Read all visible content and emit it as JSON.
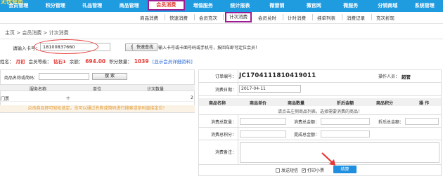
{
  "brand": "无忧会员",
  "topnav": [
    "会员管理",
    "积分管理",
    "礼品管理",
    "商品管理",
    "会员消费",
    "增值服务",
    "统计报表",
    "微营销",
    "微官网",
    "微服务",
    "分销商城",
    "系统管理"
  ],
  "subnav": [
    "商品消费",
    "快速消费",
    "会员充次",
    "计次消费",
    "会员兑时",
    "计时消费",
    "挂单列表",
    "消费记录",
    "充次折现"
  ],
  "breadcrumb": "主页 > 会员消费 > 计次消费",
  "card": {
    "label": "请输入卡号：",
    "value": "18100837660",
    "search_btn": "查 找",
    "quick_btn": "快速查找",
    "tip": "输入卡号或卡面号码或手机号，按回车即可定位会员！"
  },
  "info": {
    "name_label": "姓名：",
    "name": "月初",
    "level_label": "会员等级：",
    "level": "钻石1",
    "balance_label": "余额：",
    "balance": "694.00",
    "points_label": "积分数量：",
    "points": "1039",
    "detail_link": "[显示会员详细资料]"
  },
  "left": {
    "search_label": "商品名称或简码：",
    "search_btn": "搜 索",
    "columns": [
      "服务名称",
      "单位",
      "计次数量"
    ],
    "rows": [
      [
        "门票",
        "个",
        "2"
      ]
    ],
    "note": "点击商品即可轻松选定，也可以通过名称或简码进行搜索或条码直接定位！"
  },
  "right": {
    "order_label": "订单编号：",
    "order_no": "JC1704111810419011",
    "operator_label": "操作人员：",
    "operator": "超管",
    "date_label": "消费日期：",
    "date": "2017-04-11",
    "columns": [
      "商品名称",
      "商品单价",
      "商品数量",
      "折后金额",
      "商品积分",
      "操 作"
    ],
    "empty_note": "请点击左侧商品列表，选择需要消费的商品！",
    "count_label": "消费总数量：",
    "amount_label": "消费总金额：",
    "discount_label": "折后总金额：",
    "points_label": "消费总积分：",
    "commission_label": "提成总金额：",
    "memo_label": "消费备注：",
    "sms_label": "发送短信",
    "print_label": "打印小票",
    "print_checked": "✔",
    "submit": "结算"
  },
  "colors": {
    "nav": "#1f9be0",
    "highlight": "#9b1c93",
    "accent": "#e53935",
    "button": "#1f8fe0"
  }
}
